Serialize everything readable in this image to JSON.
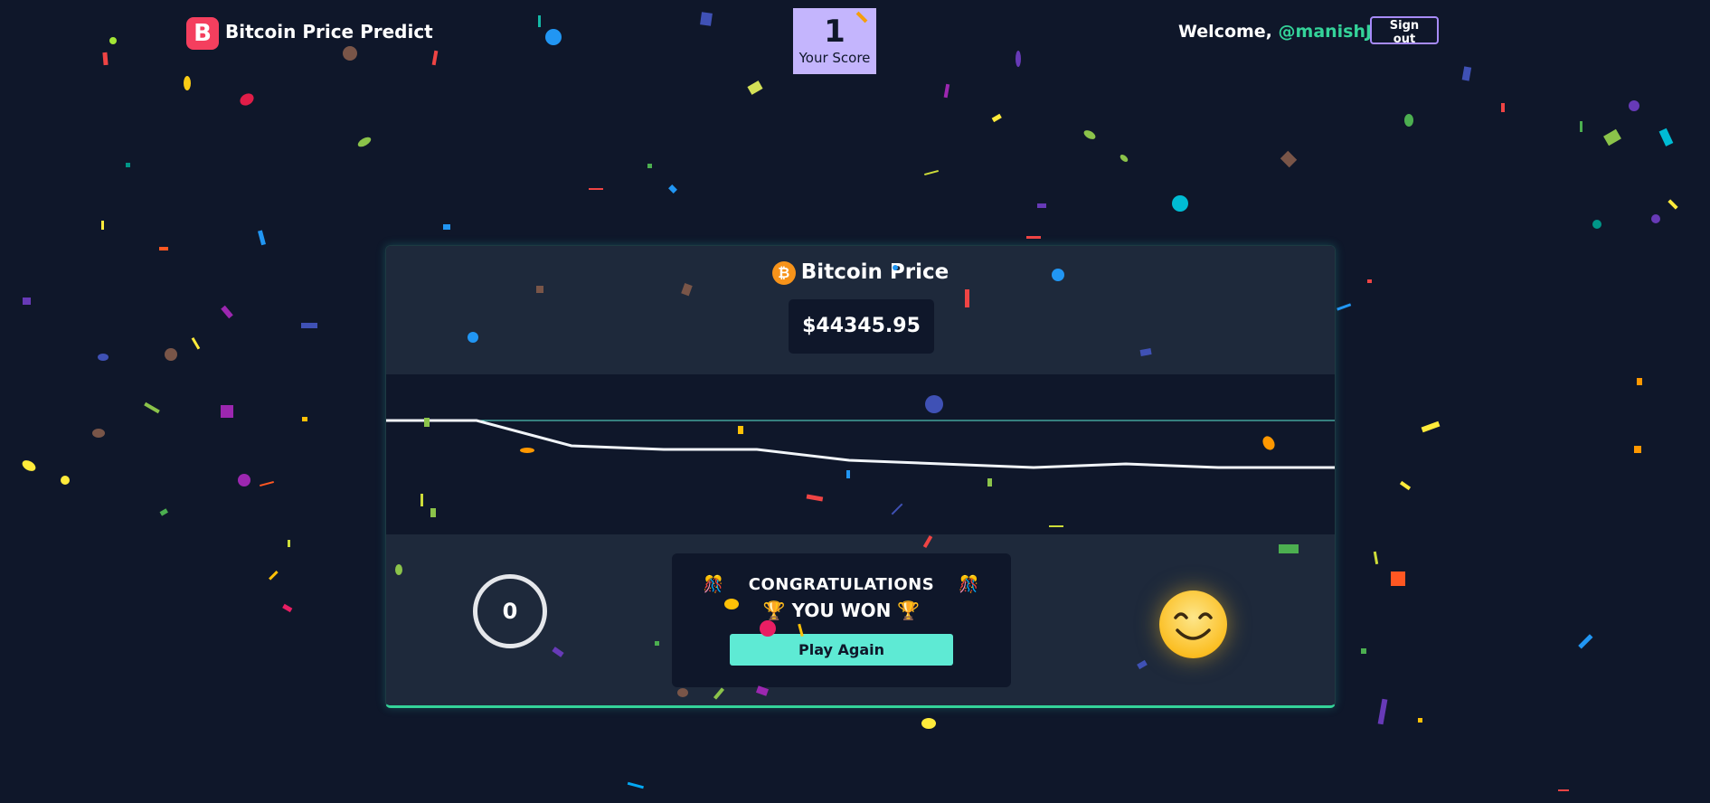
{
  "header": {
    "logo_letter": "B",
    "app_title": "Bitcoin Price Predict",
    "score_value": "1",
    "score_label": "Your Score",
    "welcome_text": "Welcome, ",
    "username": "@manishJ",
    "signout_label": "Sign out"
  },
  "price_panel": {
    "title": "Bitcoin Price",
    "btc_symbol": "₿",
    "price": "$44345.95"
  },
  "chart_data": {
    "type": "line",
    "series": [
      {
        "values": [
          44360,
          44360,
          44353,
          44352,
          44352,
          44349,
          44347,
          44348,
          44347,
          44347
        ]
      }
    ],
    "reference_value": 44360
  },
  "result": {
    "countdown": "0",
    "congrats_text": "CONGRATULATIONS",
    "won_text": "YOU WON",
    "play_again_label": "Play Again"
  },
  "colors": {
    "background": "#0f172a",
    "panel": "#1e293b",
    "accent": "#5eead4",
    "score_bg": "#c4b5fd",
    "logo": "#f43f5e",
    "username": "#34d399"
  }
}
